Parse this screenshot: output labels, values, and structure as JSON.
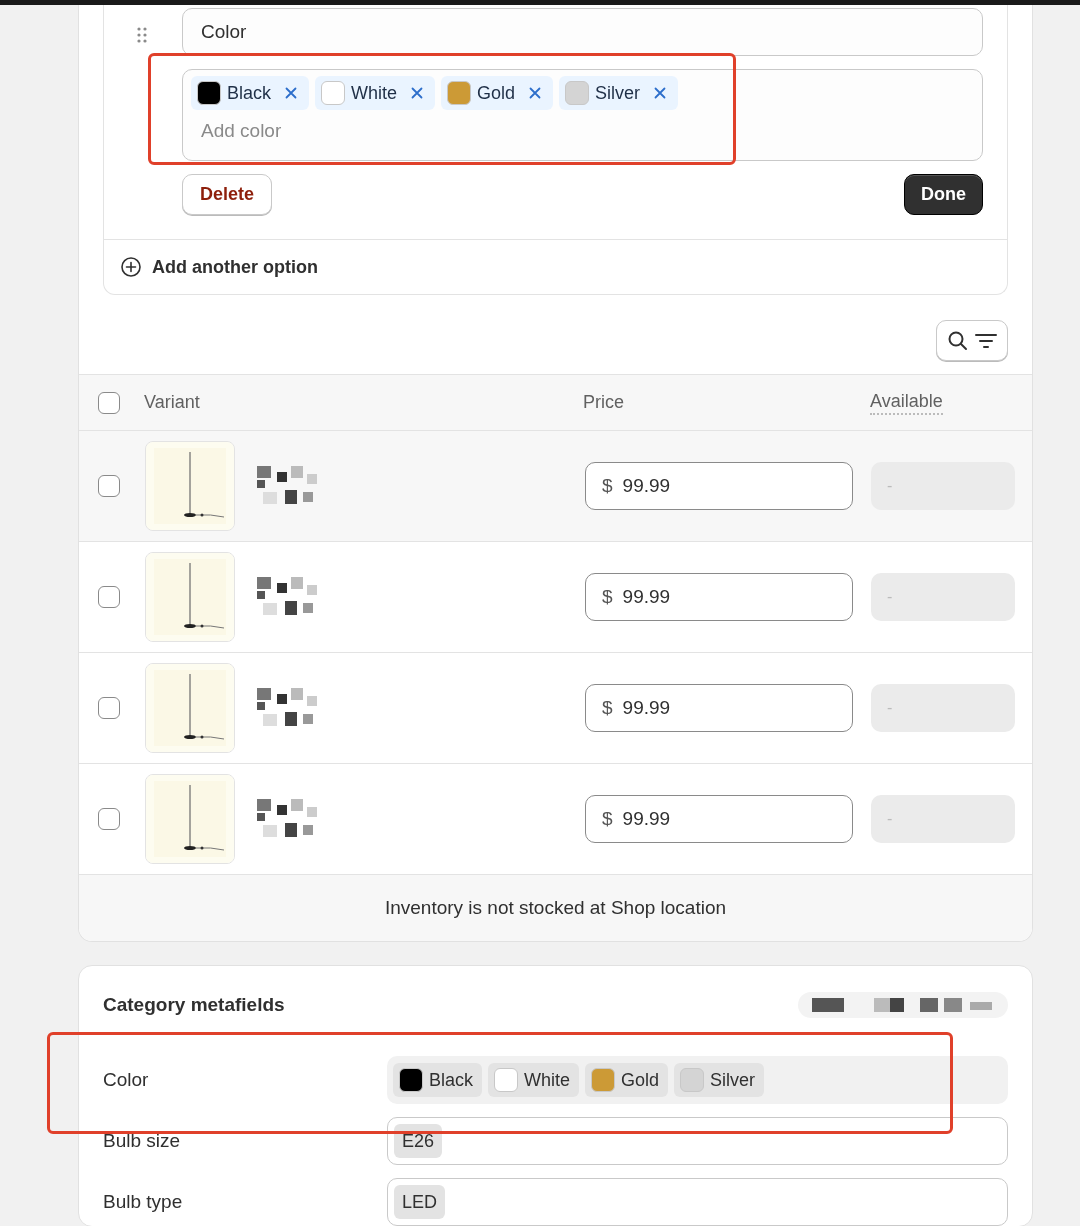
{
  "option_editor": {
    "name": "Color",
    "values": [
      {
        "label": "Black",
        "color": "#000000"
      },
      {
        "label": "White",
        "color": "#ffffff"
      },
      {
        "label": "Gold",
        "color": "#cc9a36"
      },
      {
        "label": "Silver",
        "color": "#d4d4d4"
      }
    ],
    "placeholder": "Add color",
    "delete_button": "Delete",
    "done_button": "Done",
    "add_option": "Add another option"
  },
  "variants_table": {
    "columns": [
      "Variant",
      "Price",
      "Available"
    ],
    "header_checked": false,
    "rows": [
      {
        "checked": false,
        "currency": "$",
        "price": "99.99",
        "available": "-"
      },
      {
        "checked": false,
        "currency": "$",
        "price": "99.99",
        "available": "-"
      },
      {
        "checked": false,
        "currency": "$",
        "price": "99.99",
        "available": "-"
      },
      {
        "checked": false,
        "currency": "$",
        "price": "99.99",
        "available": "-"
      }
    ],
    "footer": "Inventory is not stocked at Shop location"
  },
  "metafields": {
    "title": "Category metafields",
    "rows": [
      {
        "label": "Color",
        "kind": "swatches",
        "values": [
          {
            "label": "Black",
            "color": "#000000"
          },
          {
            "label": "White",
            "color": "#ffffff"
          },
          {
            "label": "Gold",
            "color": "#cc9a36"
          },
          {
            "label": "Silver",
            "color": "#d4d4d4"
          }
        ]
      },
      {
        "label": "Bulb size",
        "kind": "tags",
        "values": [
          {
            "label": "E26"
          }
        ]
      },
      {
        "label": "Bulb type",
        "kind": "tags",
        "values": [
          {
            "label": "LED"
          }
        ]
      }
    ]
  }
}
